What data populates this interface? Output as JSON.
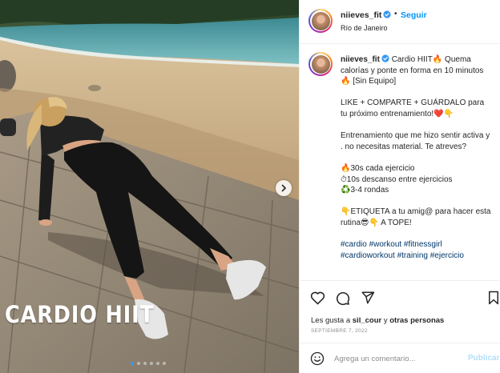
{
  "post": {
    "overlay_title": "CARDIO HIIT",
    "carousel": {
      "total_slides": 6,
      "active_slide": 1
    }
  },
  "icons": {
    "next": "chevron-right-icon",
    "verified": "verified-badge-icon",
    "like": "heart-icon",
    "comment": "comment-icon",
    "share": "paper-plane-icon",
    "save": "bookmark-icon",
    "emoji": "smiley-icon"
  },
  "colors": {
    "accent": "#0095f6",
    "verified": "#3897f0",
    "hashtag": "#00376b",
    "muted": "#8e8e8e",
    "publish_disabled": "#b2dffc"
  },
  "header": {
    "username": "niieves_fit",
    "separator": "•",
    "follow_label": "Seguir",
    "location": "Río de Janeiro"
  },
  "caption": {
    "username": "niieves_fit",
    "body": " Cardio HIIT🔥 Quema calorías y ponte en forma en 10 minutos🔥 [Sin Equipo]\n\nLIKE + COMPARTE + GUÁRDALO para tu próximo entrenamiento!❤️👇\n\nEntrenamiento que me hizo sentir activa y . no necesitas material. Te atreves?\n\n🔥30s cada ejercicio\n⏱10s descanso entre ejercicios\n♻️3-4 rondas\n\n👇ETIQUETA a tu amig@ para hacer esta rutina😎👇 A TOPE!\n\n",
    "hashtags": "#cardio #workout #fitnessgirl #cardioworkout #training #ejercicio"
  },
  "engagement": {
    "likes_prefix": "Les gusta a ",
    "likes_user": "sil_cour",
    "likes_mid": " y ",
    "likes_others": "otras personas",
    "date": "SEPTIEMBRE 7, 2022"
  },
  "comment_box": {
    "placeholder": "Agrega un comentario...",
    "publish_label": "Publicar"
  }
}
